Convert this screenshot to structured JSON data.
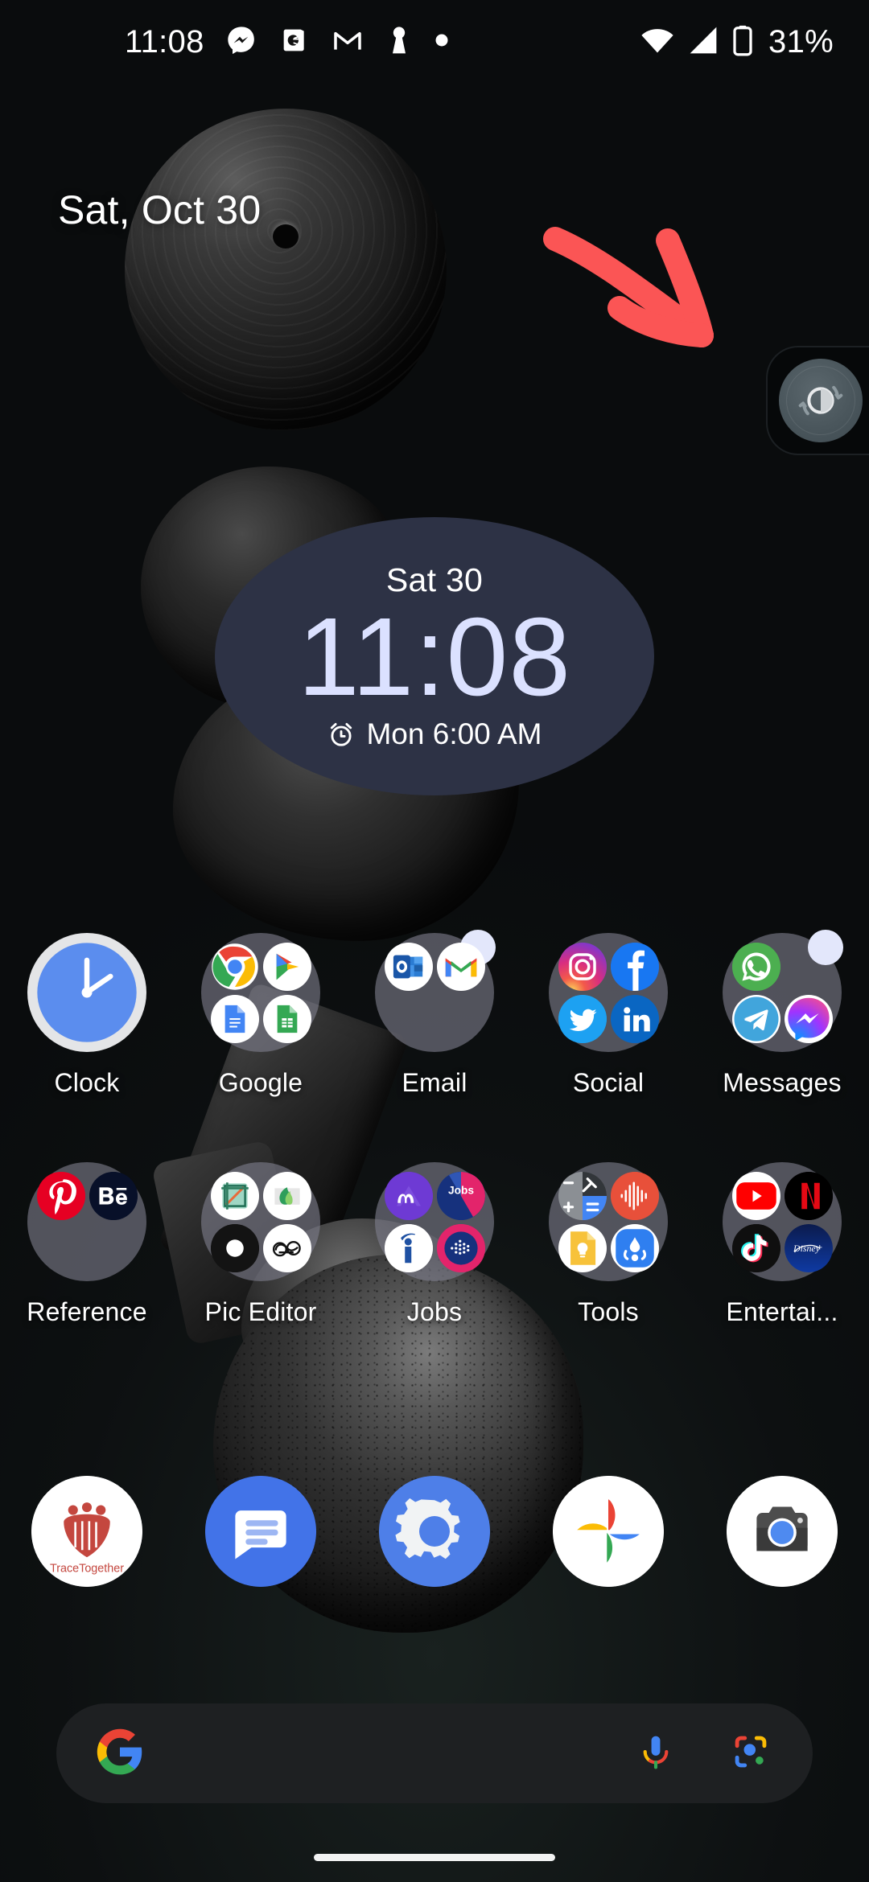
{
  "statusbar": {
    "time": "11:08",
    "battery_text": "31%",
    "left_icons": [
      "messenger-icon",
      "camera-notification-icon",
      "gmail-icon",
      "keyhole-icon",
      "dot-icon"
    ],
    "right_icons": [
      "wifi-icon",
      "cellular-signal-icon",
      "battery-icon"
    ]
  },
  "home": {
    "date": "Sat, Oct 30"
  },
  "annotation": {
    "type": "red-arrow",
    "color": "#fb5555",
    "points_to": "dark-theme-toggle-widget"
  },
  "dark_theme_widget": {
    "name": "dark-theme-toggle",
    "icon": "contrast-icon",
    "knob_color": "#4a565c",
    "panel_color": "#060809"
  },
  "clock_widget": {
    "day": "Sat 30",
    "time": "11:08",
    "alarm": "Mon 6:00 AM",
    "alarm_icon": "alarm-clock-icon",
    "background": "#2d3245",
    "time_color": "#dbe1ff"
  },
  "app_grid": {
    "rows": [
      [
        {
          "label": "Clock",
          "kind": "app",
          "icon": "clock-app-icon"
        },
        {
          "label": "Google",
          "kind": "folder",
          "badge": false,
          "apps": [
            "chrome-icon",
            "play-store-icon",
            "google-docs-icon",
            "google-sheets-icon"
          ]
        },
        {
          "label": "Email",
          "kind": "folder",
          "badge": true,
          "apps": [
            "outlook-icon",
            "gmail-icon",
            "blank-icon",
            "blank-icon"
          ]
        },
        {
          "label": "Social",
          "kind": "folder",
          "badge": false,
          "apps": [
            "instagram-icon",
            "facebook-icon",
            "twitter-icon",
            "linkedin-icon"
          ]
        },
        {
          "label": "Messages",
          "kind": "folder",
          "badge": true,
          "apps": [
            "whatsapp-icon",
            "blank-icon",
            "telegram-icon",
            "messenger-icon"
          ]
        }
      ],
      [
        {
          "label": "Reference",
          "kind": "folder",
          "badge": false,
          "apps": [
            "pinterest-icon",
            "behance-icon",
            "blank-icon",
            "blank-icon"
          ]
        },
        {
          "label": "Pic Editor",
          "kind": "folder",
          "badge": false,
          "apps": [
            "photo-crop-icon",
            "snapseed-icon",
            "lightroom-black-icon",
            "sketch-white-icon"
          ]
        },
        {
          "label": "Jobs",
          "kind": "folder",
          "badge": false,
          "apps": [
            "monster-icon",
            "jobs-icon",
            "indeed-icon",
            "jobstreet-icon"
          ]
        },
        {
          "label": "Tools",
          "kind": "folder",
          "badge": false,
          "apps": [
            "calculator-icon",
            "recorder-icon",
            "google-keep-icon",
            "files-share-icon"
          ]
        },
        {
          "label": "Entertai...",
          "kind": "folder",
          "badge": false,
          "apps": [
            "youtube-icon",
            "netflix-icon",
            "tiktok-icon",
            "disney-plus-icon"
          ]
        }
      ]
    ]
  },
  "dock": {
    "items": [
      {
        "name": "tracetogether-app",
        "icon": "tracetogether-icon",
        "label_text": "TraceTogether"
      },
      {
        "name": "messages-app",
        "icon": "messages-icon"
      },
      {
        "name": "settings-app",
        "icon": "settings-gear-icon"
      },
      {
        "name": "google-photos-app",
        "icon": "google-photos-icon"
      },
      {
        "name": "camera-app",
        "icon": "camera-icon"
      }
    ]
  },
  "search": {
    "placeholder": "",
    "value": "",
    "logo_icon": "google-g-icon",
    "mic_icon": "microphone-icon",
    "lens_icon": "google-lens-icon"
  },
  "nav": {
    "pill": "home-gesture-pill"
  },
  "colors": {
    "accent_blue": "#4285f4",
    "red": "#ea4335",
    "yellow": "#fbbc05",
    "green": "#34a853",
    "annotation_red": "#fb5555",
    "widget_bg": "#2d3245"
  }
}
